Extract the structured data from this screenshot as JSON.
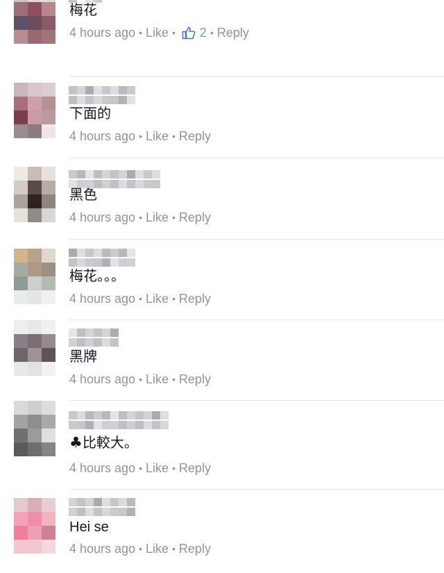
{
  "comments": [
    {
      "text": "梅花",
      "time": "4 hours ago",
      "like": "Like",
      "reply": "Reply",
      "likes": "2",
      "avatar": [
        "#c7c3c6",
        "#dcd8da",
        "#dedada",
        "#9b6e78",
        "#8f4f5c",
        "#b9868e",
        "#5d5068",
        "#6b4c5b",
        "#8d5b68",
        "#b78d93",
        "#986875",
        "#a07479"
      ]
    },
    {
      "text": "下面的",
      "time": "4 hours ago",
      "like": "Like",
      "reply": "Reply",
      "avatar": [
        "#cbb6c0",
        "#d9c5cc",
        "#dccdd3",
        "#a6707e",
        "#cfa0ab",
        "#b79097",
        "#7a3d4f",
        "#c99ba5",
        "#b99a9f",
        "#9a8a92",
        "#8e7a82",
        "#efe4e7"
      ]
    },
    {
      "text": "黑色",
      "time": "4 hours ago",
      "like": "Like",
      "reply": "Reply",
      "avatar": [
        "#efeae6",
        "#c9bcb3",
        "#e9e1dd",
        "#d4cbc4",
        "#5b4b45",
        "#b9aca5",
        "#a9a39c",
        "#2d2320",
        "#8e8581",
        "#e5e1dc",
        "#8f8c88",
        "#d9d6d3"
      ]
    },
    {
      "text": "梅花。。。",
      "time": "4 hours ago",
      "like": "Like",
      "reply": "Reply",
      "avatar": [
        "#d4b58a",
        "#b9a28a",
        "#e1d7cc",
        "#a7aaa4",
        "#ad9886",
        "#9c8f84",
        "#8f9b97",
        "#cdcfcb",
        "#b6bab7",
        "#e8ece9",
        "#e3e6e4",
        "#eff1ef"
      ]
    },
    {
      "text": "黑牌",
      "time": "4 hours ago",
      "like": "Like",
      "reply": "Reply",
      "avatar": [
        "#eeeeee",
        "#e9e9e9",
        "#f0f0f0",
        "#8a7f86",
        "#7a6e74",
        "#97898f",
        "#6f6468",
        "#9e9294",
        "#5e5357",
        "#e8e8e8",
        "#e2e2e2",
        "#f2f2f2"
      ]
    },
    {
      "text": "比較大。",
      "club": "♣",
      "time": "4 hours ago",
      "like": "Like",
      "reply": "Reply",
      "avatar": [
        "#d9d9d9",
        "#cfcfcf",
        "#dddddd",
        "#a3a3a3",
        "#8e8e8e",
        "#a9a9a9",
        "#707070",
        "#9b9b9b",
        "#e0e0e0",
        "#5a5a5a",
        "#6d6d6d",
        "#848484"
      ]
    },
    {
      "text": "Hei se",
      "time": "4 hours ago",
      "like": "Like",
      "reply": "Reply",
      "avatar": [
        "#e6c9cf",
        "#d9aeb8",
        "#e8cdd3",
        "#f3a2b8",
        "#ef8ea8",
        "#f1b3c2",
        "#f07f9c",
        "#eca0b4",
        "#cf8193",
        "#f4c6d1",
        "#f1c8d1",
        "#f5d8de"
      ]
    }
  ],
  "colors": {
    "text": "#141823",
    "meta": "#90949c",
    "like_icon": "#4a76c6",
    "divider": "#e3e5e8"
  },
  "icons": {
    "like": "thumbs-up-icon"
  }
}
